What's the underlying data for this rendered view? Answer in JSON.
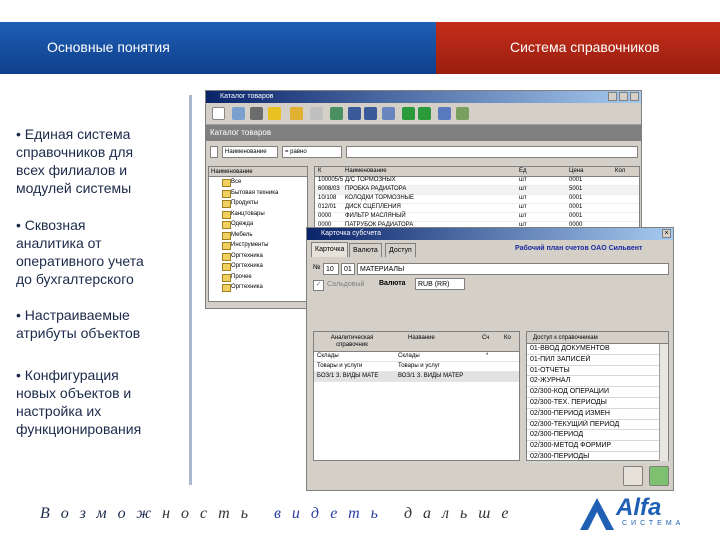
{
  "header": {
    "left_title": "Основные понятия",
    "right_title": "Система справочников"
  },
  "bullets": [
    "• Единая система\n  справочников для\n  всех филиалов и\n  модулей системы",
    "• Сквозная\n  аналитика от\n  оперативного учета\n  до бухгалтерского",
    "• Настраиваемые\n  атрибуты объектов",
    "• Конфигурация\n  новых объектов и\n  настройка их\n  функционирования"
  ],
  "window1": {
    "title": "Каталог товаров",
    "caption": "Каталог товаров",
    "filter_field": "Наименование",
    "filter_op": "= равно",
    "tree_header": "Наименование",
    "tree_items": [
      "Все",
      "Бытовая техника",
      "Продукты",
      "Канцтовары",
      "Одежда",
      "Мебель",
      "Инструменты",
      "Оргтехника",
      "Оргтехника",
      "Прочее",
      "Оргтехника"
    ],
    "grid_headers": [
      "К",
      "Наименование",
      "Ед",
      "Цена",
      "Кол"
    ],
    "rows": [
      {
        "code": "100005/5",
        "name": "Д/С ТОРМОЗНЫХ",
        "unit": "шт",
        "price": "0001",
        "qty": ""
      },
      {
        "code": "6008/03",
        "name": "ПРОБКА РАДИАТОРА",
        "unit": "шт",
        "price": "5001",
        "qty": ""
      },
      {
        "code": "10/108",
        "name": "КОЛОДКИ ТОРМОЗНЫЕ",
        "unit": "шт",
        "price": "0001",
        "qty": ""
      },
      {
        "code": "012/01",
        "name": "ДИСК СЦЕПЛЕНИЯ",
        "unit": "шт",
        "price": "0001",
        "qty": ""
      },
      {
        "code": "0000",
        "name": "ФИЛЬТР МАСЛЯНЫЙ",
        "unit": "шт",
        "price": "0001",
        "qty": ""
      },
      {
        "code": "0000",
        "name": "ПАТРУБОК РАДИАТОРА",
        "unit": "шт",
        "price": "0000",
        "qty": ""
      }
    ]
  },
  "window2": {
    "title": "Карточка субсчета",
    "tabs": [
      "Карточка",
      "Валюта",
      "Доступ"
    ],
    "plan_title": "Рабочий план счетов OAO Сильвент",
    "n_label": "№",
    "account_code": "10",
    "sub_code": "01",
    "account_name": "МАТЕРИАЛЫ",
    "balance_label": "Сальдовый",
    "currency_label": "Валюта",
    "currency_value": "RUB (RR)",
    "analytics_headers": [
      "Аналитическая справочник",
      "Название",
      "Сч",
      "Ко"
    ],
    "analytics_rows": [
      {
        "a": "Склады",
        "b": "Склады",
        "c": "*"
      },
      {
        "a": "Товары и услуги",
        "b": "Товары и услуг",
        "c": ""
      },
      {
        "a": "БОЗ/1 З. ВИДЫ МАТЕ",
        "b": "ВОЗ/1 З. ВИДЫ МАТЕР",
        "c": ""
      }
    ],
    "corr_header": "Доступ к справочникам",
    "corr_items": [
      "01-ВВОД ДОКУМЕНТОВ",
      "01-ПИЛ ЗАПИСЕЙ",
      "01-ОТЧЕТЫ",
      "02-ЖУРНАЛ",
      "02/300-КОД ОПЕРАЦИИ",
      "02/300-ТЕХ. ПЕРИОДЫ",
      "02/300-ПЕРИОД ИЗМЕН",
      "02/300-ТЕКУЩИЙ ПЕРИОД",
      "02/300-ПЕРИОД",
      "02/300-МЕТОД ФОРМИР",
      "02/300-ПЕРИОДЫ"
    ]
  },
  "footer": {
    "part1": "Возмож",
    "part2": "ность",
    "part3": "видеть",
    "part4": "дальше"
  },
  "logo": {
    "word": "Alfa",
    "subtitle": "СИСТЕМА"
  }
}
